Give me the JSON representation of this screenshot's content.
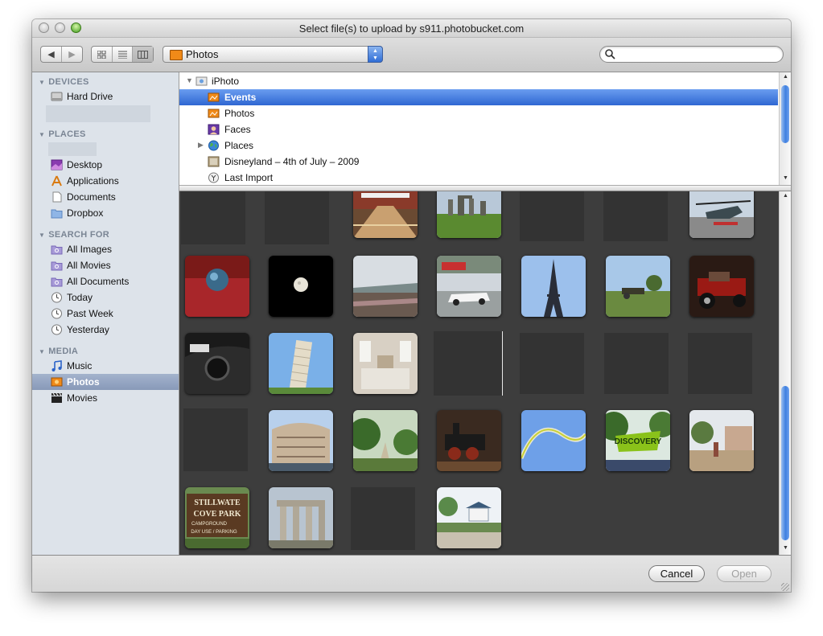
{
  "window": {
    "title": "Select file(s) to upload by s911.photobucket.com"
  },
  "toolbar": {
    "back_icon": "back-arrow-icon",
    "forward_icon": "forward-arrow-icon",
    "view_icons": [
      "icon-view-icon",
      "list-view-icon",
      "column-view-icon"
    ],
    "location": "Photos",
    "search_placeholder": ""
  },
  "sidebar": {
    "devices": {
      "header": "DEVICES",
      "items": [
        {
          "label": "Hard Drive",
          "icon": "hard-drive-icon"
        }
      ]
    },
    "places": {
      "header": "PLACES",
      "items": [
        {
          "label": "Desktop",
          "icon": "desktop-icon"
        },
        {
          "label": "Applications",
          "icon": "applications-icon"
        },
        {
          "label": "Documents",
          "icon": "document-icon"
        },
        {
          "label": "Dropbox",
          "icon": "folder-icon"
        }
      ]
    },
    "search_for": {
      "header": "SEARCH FOR",
      "items": [
        {
          "label": "All Images",
          "icon": "smart-folder-icon"
        },
        {
          "label": "All Movies",
          "icon": "smart-folder-icon"
        },
        {
          "label": "All Documents",
          "icon": "smart-folder-icon"
        },
        {
          "label": "Today",
          "icon": "clock-icon"
        },
        {
          "label": "Past Week",
          "icon": "clock-icon"
        },
        {
          "label": "Yesterday",
          "icon": "clock-icon"
        }
      ]
    },
    "media": {
      "header": "MEDIA",
      "items": [
        {
          "label": "Music",
          "icon": "music-note-icon"
        },
        {
          "label": "Photos",
          "icon": "photos-icon",
          "selected": true
        },
        {
          "label": "Movies",
          "icon": "movie-clapper-icon"
        }
      ]
    }
  },
  "browser": {
    "items": [
      {
        "label": "iPhoto",
        "icon": "iphoto-icon"
      },
      {
        "label": "Events",
        "icon": "events-icon",
        "selected": true
      },
      {
        "label": "Photos",
        "icon": "photos-icon"
      },
      {
        "label": "Faces",
        "icon": "faces-icon"
      },
      {
        "label": "Places",
        "icon": "globe-icon"
      },
      {
        "label": "Disneyland – 4th of July – 2009",
        "icon": "album-icon"
      },
      {
        "label": "Last Import",
        "icon": "last-import-icon"
      }
    ]
  },
  "grid": {
    "rows": [
      [
        "blank",
        "blank",
        "bowling-alley",
        "stonehenge",
        "blank",
        "blank",
        "helicopter"
      ],
      [
        "red-sphere",
        "full-moon",
        "stadium-crowd",
        "race-car",
        "eiffel-tower",
        "field-cannon",
        "hot-rod"
      ],
      [
        "bmw-interior",
        "leaning-tower-of-pisa",
        "bedroom",
        "blank",
        "blank",
        "blank",
        "blank"
      ],
      [
        "blank",
        "colosseum",
        "garden-path",
        "steam-locomotive",
        "roller-coaster",
        "discovery-island-sign",
        "garden-fountain"
      ],
      [
        "stillwater-sign",
        "greek-ruins",
        "blank",
        "gazebo-park"
      ]
    ],
    "sign_text": [
      "STILLWATE",
      "COVE PARK",
      "CAMPGROUND",
      "DAY USE / PARKING"
    ],
    "discovery_text": "DISCOVERY"
  },
  "buttons": {
    "cancel": "Cancel",
    "open": "Open"
  },
  "colors": {
    "selection_blue": "#3d74da",
    "sidebar_bg": "#dde3ea",
    "grid_bg": "#3d3d3d"
  }
}
